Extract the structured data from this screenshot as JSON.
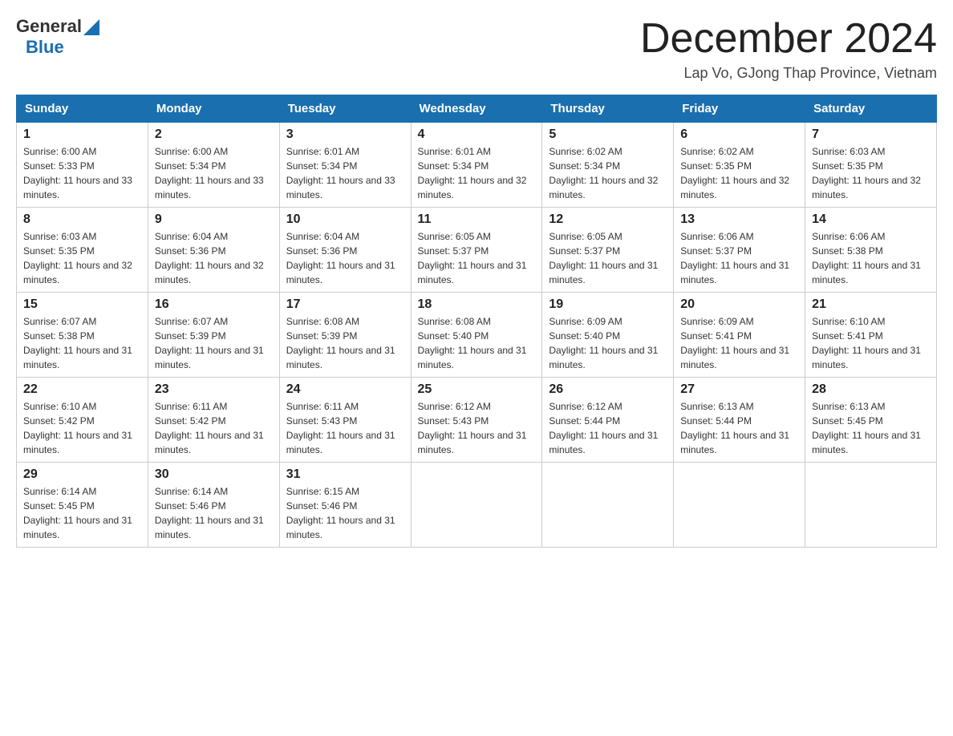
{
  "logo": {
    "general": "General",
    "blue": "Blue"
  },
  "header": {
    "title": "December 2024",
    "subtitle": "Lap Vo, GJong Thap Province, Vietnam"
  },
  "days_of_week": [
    "Sunday",
    "Monday",
    "Tuesday",
    "Wednesday",
    "Thursday",
    "Friday",
    "Saturday"
  ],
  "weeks": [
    [
      {
        "day": "1",
        "sunrise": "6:00 AM",
        "sunset": "5:33 PM",
        "daylight": "11 hours and 33 minutes."
      },
      {
        "day": "2",
        "sunrise": "6:00 AM",
        "sunset": "5:34 PM",
        "daylight": "11 hours and 33 minutes."
      },
      {
        "day": "3",
        "sunrise": "6:01 AM",
        "sunset": "5:34 PM",
        "daylight": "11 hours and 33 minutes."
      },
      {
        "day": "4",
        "sunrise": "6:01 AM",
        "sunset": "5:34 PM",
        "daylight": "11 hours and 32 minutes."
      },
      {
        "day": "5",
        "sunrise": "6:02 AM",
        "sunset": "5:34 PM",
        "daylight": "11 hours and 32 minutes."
      },
      {
        "day": "6",
        "sunrise": "6:02 AM",
        "sunset": "5:35 PM",
        "daylight": "11 hours and 32 minutes."
      },
      {
        "day": "7",
        "sunrise": "6:03 AM",
        "sunset": "5:35 PM",
        "daylight": "11 hours and 32 minutes."
      }
    ],
    [
      {
        "day": "8",
        "sunrise": "6:03 AM",
        "sunset": "5:35 PM",
        "daylight": "11 hours and 32 minutes."
      },
      {
        "day": "9",
        "sunrise": "6:04 AM",
        "sunset": "5:36 PM",
        "daylight": "11 hours and 32 minutes."
      },
      {
        "day": "10",
        "sunrise": "6:04 AM",
        "sunset": "5:36 PM",
        "daylight": "11 hours and 31 minutes."
      },
      {
        "day": "11",
        "sunrise": "6:05 AM",
        "sunset": "5:37 PM",
        "daylight": "11 hours and 31 minutes."
      },
      {
        "day": "12",
        "sunrise": "6:05 AM",
        "sunset": "5:37 PM",
        "daylight": "11 hours and 31 minutes."
      },
      {
        "day": "13",
        "sunrise": "6:06 AM",
        "sunset": "5:37 PM",
        "daylight": "11 hours and 31 minutes."
      },
      {
        "day": "14",
        "sunrise": "6:06 AM",
        "sunset": "5:38 PM",
        "daylight": "11 hours and 31 minutes."
      }
    ],
    [
      {
        "day": "15",
        "sunrise": "6:07 AM",
        "sunset": "5:38 PM",
        "daylight": "11 hours and 31 minutes."
      },
      {
        "day": "16",
        "sunrise": "6:07 AM",
        "sunset": "5:39 PM",
        "daylight": "11 hours and 31 minutes."
      },
      {
        "day": "17",
        "sunrise": "6:08 AM",
        "sunset": "5:39 PM",
        "daylight": "11 hours and 31 minutes."
      },
      {
        "day": "18",
        "sunrise": "6:08 AM",
        "sunset": "5:40 PM",
        "daylight": "11 hours and 31 minutes."
      },
      {
        "day": "19",
        "sunrise": "6:09 AM",
        "sunset": "5:40 PM",
        "daylight": "11 hours and 31 minutes."
      },
      {
        "day": "20",
        "sunrise": "6:09 AM",
        "sunset": "5:41 PM",
        "daylight": "11 hours and 31 minutes."
      },
      {
        "day": "21",
        "sunrise": "6:10 AM",
        "sunset": "5:41 PM",
        "daylight": "11 hours and 31 minutes."
      }
    ],
    [
      {
        "day": "22",
        "sunrise": "6:10 AM",
        "sunset": "5:42 PM",
        "daylight": "11 hours and 31 minutes."
      },
      {
        "day": "23",
        "sunrise": "6:11 AM",
        "sunset": "5:42 PM",
        "daylight": "11 hours and 31 minutes."
      },
      {
        "day": "24",
        "sunrise": "6:11 AM",
        "sunset": "5:43 PM",
        "daylight": "11 hours and 31 minutes."
      },
      {
        "day": "25",
        "sunrise": "6:12 AM",
        "sunset": "5:43 PM",
        "daylight": "11 hours and 31 minutes."
      },
      {
        "day": "26",
        "sunrise": "6:12 AM",
        "sunset": "5:44 PM",
        "daylight": "11 hours and 31 minutes."
      },
      {
        "day": "27",
        "sunrise": "6:13 AM",
        "sunset": "5:44 PM",
        "daylight": "11 hours and 31 minutes."
      },
      {
        "day": "28",
        "sunrise": "6:13 AM",
        "sunset": "5:45 PM",
        "daylight": "11 hours and 31 minutes."
      }
    ],
    [
      {
        "day": "29",
        "sunrise": "6:14 AM",
        "sunset": "5:45 PM",
        "daylight": "11 hours and 31 minutes."
      },
      {
        "day": "30",
        "sunrise": "6:14 AM",
        "sunset": "5:46 PM",
        "daylight": "11 hours and 31 minutes."
      },
      {
        "day": "31",
        "sunrise": "6:15 AM",
        "sunset": "5:46 PM",
        "daylight": "11 hours and 31 minutes."
      },
      null,
      null,
      null,
      null
    ]
  ],
  "colors": {
    "header_bg": "#1a6faf",
    "header_text": "#ffffff"
  }
}
